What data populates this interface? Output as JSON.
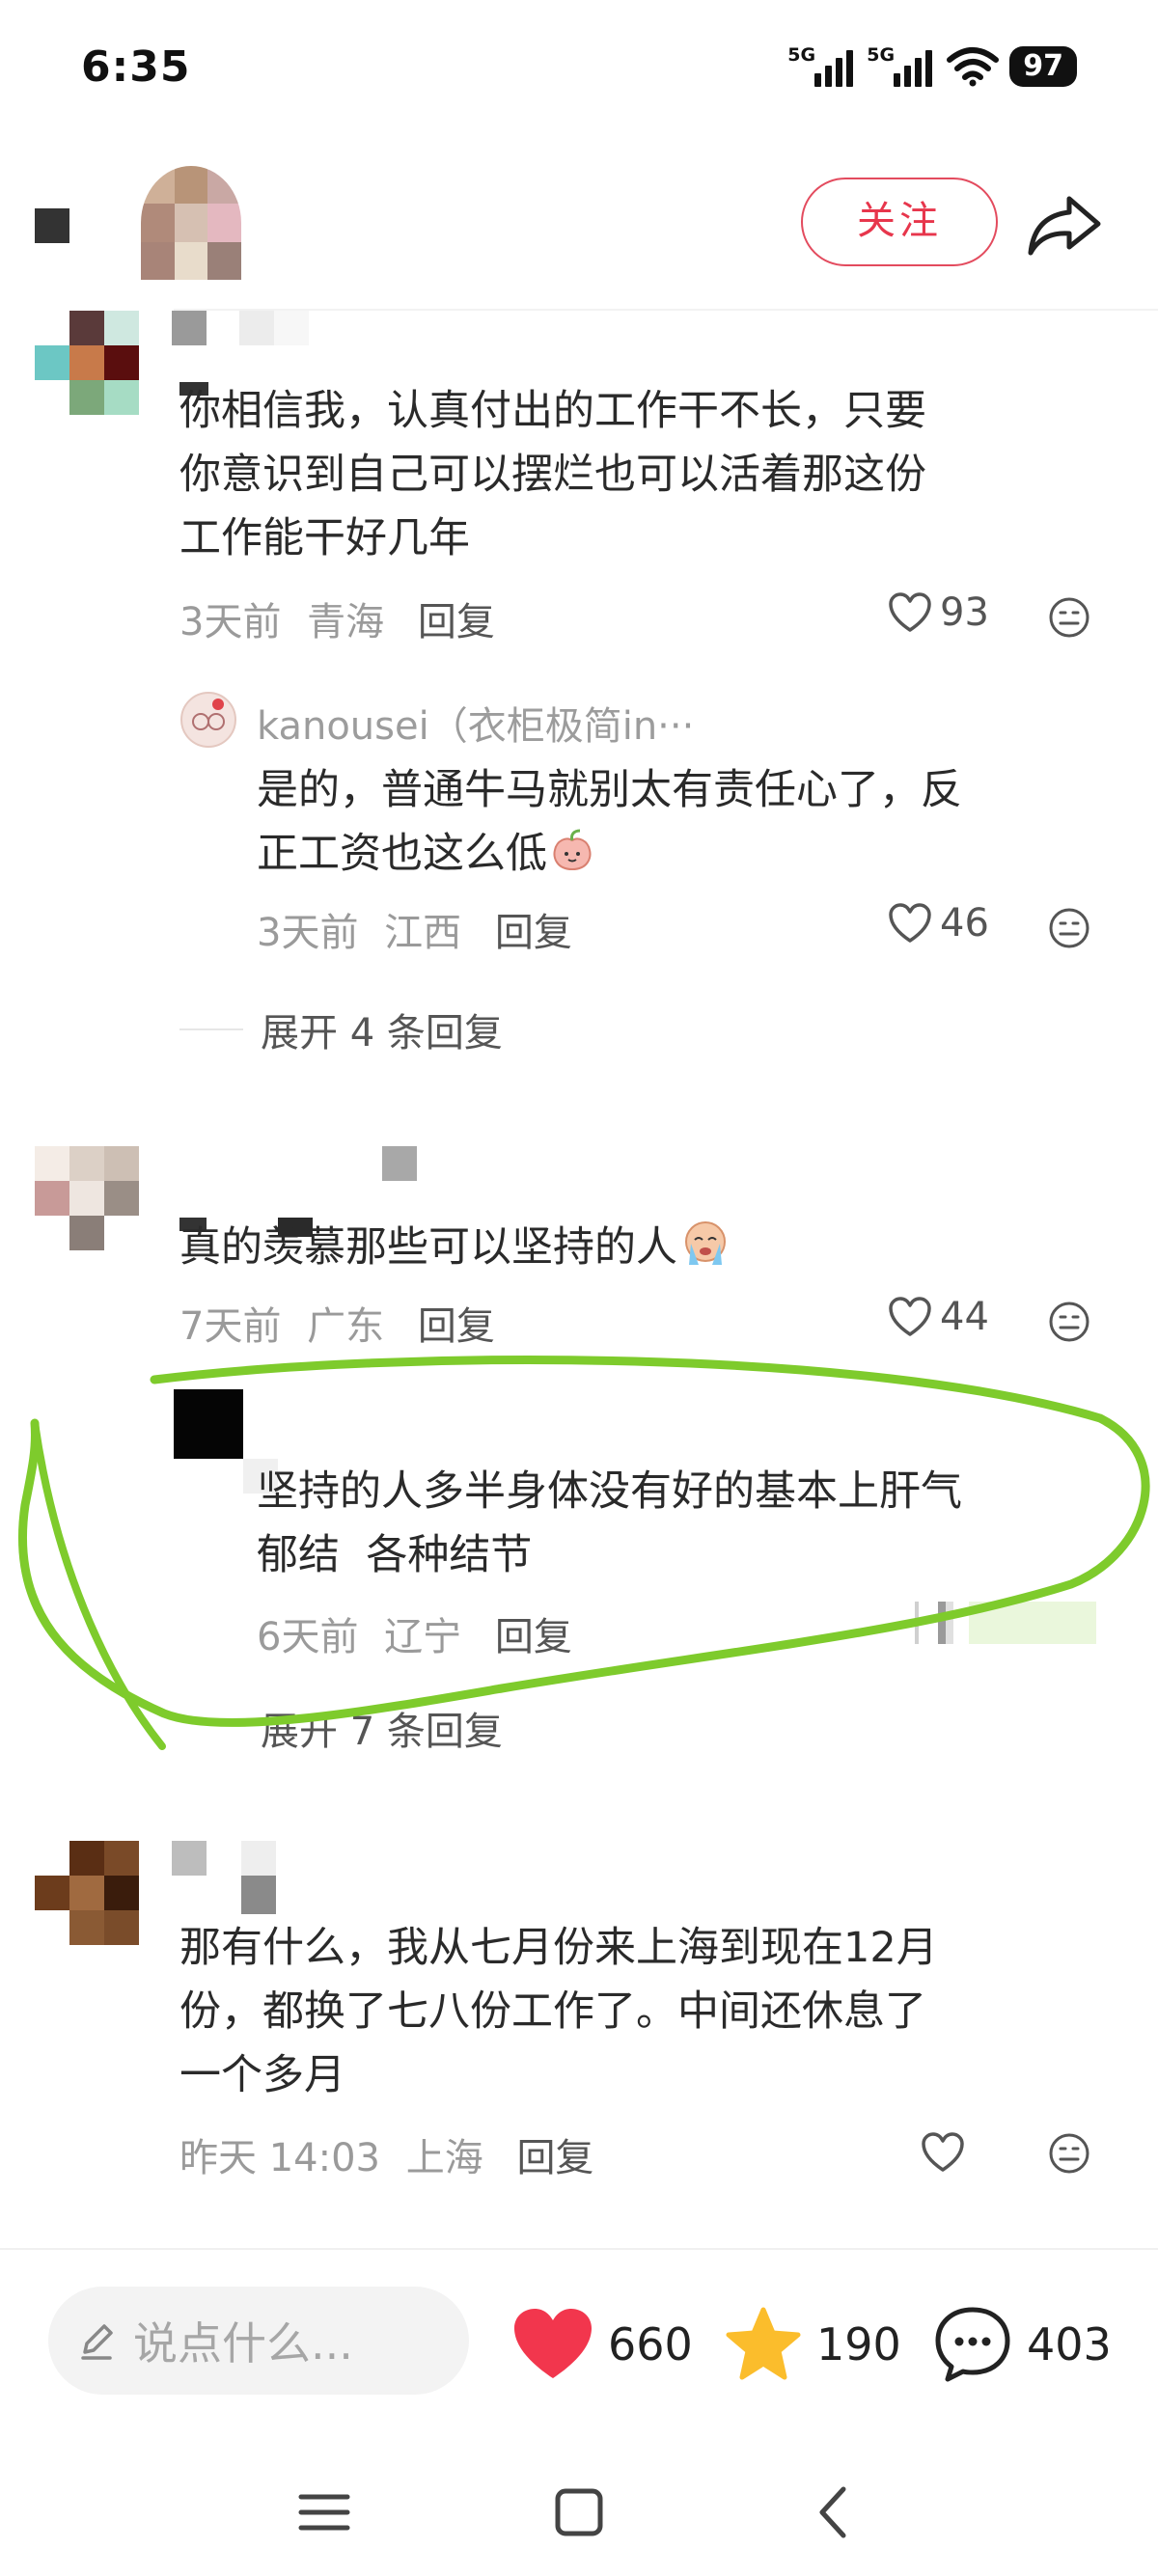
{
  "status": {
    "time": "6:35",
    "signal1": "5G",
    "signal2": "5G",
    "battery": "97"
  },
  "header": {
    "follow_label": "关注"
  },
  "comments": [
    {
      "text_lines": [
        "你相信我，认真付出的工作干不长，只要",
        "你意识到自己可以摆烂也可以活着那这份",
        "工作能干好几年"
      ],
      "time": "3天前",
      "location": "青海",
      "reply": "回复",
      "likes": "93",
      "sub_reply": {
        "username": "kanousei（衣柜极简in···",
        "text_lines": [
          "是的，普通牛马就别太有责任心了，反",
          "正工资也这么低"
        ],
        "time": "3天前",
        "location": "江西",
        "reply": "回复",
        "likes": "46"
      },
      "expand": "展开 4 条回复"
    },
    {
      "text_lines": [
        "真的羡慕那些可以坚持的人"
      ],
      "time": "7天前",
      "location": "广东",
      "reply": "回复",
      "likes": "44",
      "sub_reply": {
        "text_lines": [
          "坚持的人多半身体没有好的基本上肝气",
          "郁结  各种结节"
        ],
        "time": "6天前",
        "location": "辽宁",
        "reply": "回复"
      },
      "expand": "展开 7 条回复"
    },
    {
      "text_lines": [
        "那有什么，我从七月份来上海到现在12月",
        "份，都换了七八份工作了。中间还休息了",
        "一个多月"
      ],
      "time": "昨天 14:03",
      "location": "上海",
      "reply": "回复"
    }
  ],
  "bottom_bar": {
    "placeholder": "说点什么...",
    "likes": "660",
    "favorites": "190",
    "comments": "403"
  },
  "colors": {
    "accent": "#e7364c",
    "heart": "#f2364d",
    "star": "#fbbd2c",
    "annotation": "#7ecb2c"
  }
}
